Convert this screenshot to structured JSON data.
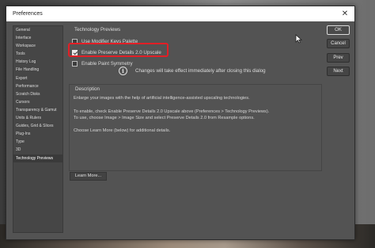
{
  "window": {
    "title": "Preferences"
  },
  "sidebar": {
    "items": [
      {
        "label": "General"
      },
      {
        "label": "Interface"
      },
      {
        "label": "Workspace"
      },
      {
        "label": "Tools"
      },
      {
        "label": "History Log"
      },
      {
        "label": "File Handling"
      },
      {
        "label": "Export"
      },
      {
        "label": "Performance"
      },
      {
        "label": "Scratch Disks"
      },
      {
        "label": "Cursors"
      },
      {
        "label": "Transparency & Gamut"
      },
      {
        "label": "Units & Rulers"
      },
      {
        "label": "Guides, Grid & Slices"
      },
      {
        "label": "Plug-Ins"
      },
      {
        "label": "Type"
      },
      {
        "label": "3D"
      },
      {
        "label": "Technology Previews",
        "selected": true
      }
    ]
  },
  "technology_previews": {
    "group_label": "Technology Previews",
    "options": [
      {
        "label": "Use Modifier Keys Palette",
        "checked": false
      },
      {
        "label": "Enable Preserve Details 2.0 Upscale",
        "checked": true,
        "highlighted": true
      },
      {
        "label": "Enable Paint Symmetry",
        "checked": false
      }
    ],
    "info_icon": "info-circle-icon",
    "info_text": "Changes will take effect immediately after closing this dialog"
  },
  "description": {
    "label": "Description",
    "lines": [
      "Enlarge your images with the help of artificial intelligence-assisted upscaling technologies.",
      "To enable, check Enable Preserve Details 2.0 Upscale above (Preferences > Technology Previews).",
      "To use, choose Image > Image Size and select Preserve Details 2.0 from Resample options.",
      "Choose Learn More (below) for additional details."
    ]
  },
  "learn_more_label": "Learn More...",
  "buttons": {
    "ok": "OK",
    "cancel": "Cancel",
    "prev": "Prev",
    "next": "Next"
  },
  "colors": {
    "dialog_bg": "#535353",
    "highlight": "#e21f26",
    "text": "#dcdcdc"
  }
}
